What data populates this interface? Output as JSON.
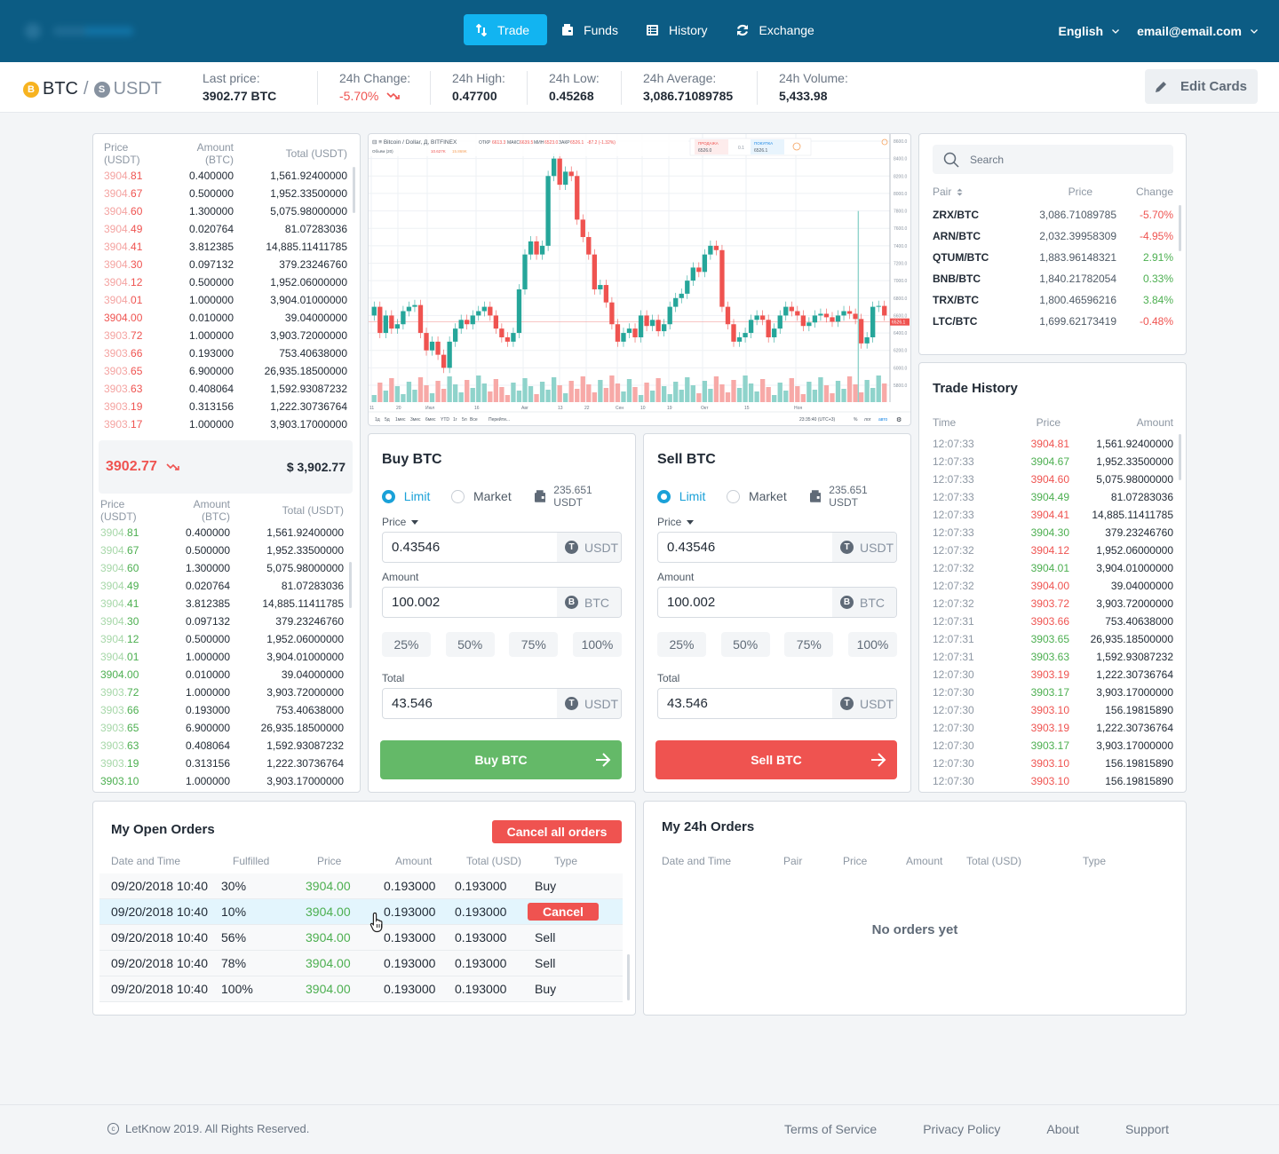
{
  "header": {
    "nav": [
      {
        "label": "Trade",
        "icon": "arrows-swap-icon",
        "active": true
      },
      {
        "label": "Funds",
        "icon": "wallet-icon",
        "active": false
      },
      {
        "label": "History",
        "icon": "list-icon",
        "active": false
      },
      {
        "label": "Exchange",
        "icon": "refresh-icon",
        "active": false
      }
    ],
    "language": "English",
    "account": "email@email.com"
  },
  "ticker": {
    "base": "BTC",
    "separator": "/",
    "quote": "USDT",
    "base_icon": "B",
    "quote_icon": "S",
    "stats": [
      {
        "label": "Last price:",
        "value": "3902.77 BTC"
      },
      {
        "label": "24h Change:",
        "value": "-5.70%",
        "negative": true
      },
      {
        "label": "24h High:",
        "value": "0.47700"
      },
      {
        "label": "24h Low:",
        "value": "0.45268"
      },
      {
        "label": "24h Average:",
        "value": "3,086.71089785"
      },
      {
        "label": "24h Volume:",
        "value": "5,433.98"
      }
    ],
    "edit_cards": "Edit Cards"
  },
  "orderbook": {
    "headers": [
      "Price (USDT)",
      "Amount (BTC)",
      "Total (USDT)"
    ],
    "asks": [
      {
        "int": "3904.",
        "dec": "81",
        "amount": "0.400000",
        "total": "1,561.92400000"
      },
      {
        "int": "3904.",
        "dec": "67",
        "amount": "0.500000",
        "total": "1,952.33500000"
      },
      {
        "int": "3904.",
        "dec": "60",
        "amount": "1.300000",
        "total": "5,075.98000000"
      },
      {
        "int": "3904.",
        "dec": "49",
        "amount": "0.020764",
        "total": "81.07283036"
      },
      {
        "int": "3904.",
        "dec": "41",
        "amount": "3.812385",
        "total": "14,885.11411785"
      },
      {
        "int": "3904.",
        "dec": "30",
        "amount": "0.097132",
        "total": "379.23246760"
      },
      {
        "int": "3904.",
        "dec": "12",
        "amount": "0.500000",
        "total": "1,952.06000000"
      },
      {
        "int": "3904.",
        "dec": "01",
        "amount": "1.000000",
        "total": "3,904.01000000"
      },
      {
        "int": "3904.00",
        "dec": "",
        "amount": "0.010000",
        "total": "39.04000000",
        "full": true
      },
      {
        "int": "3903.",
        "dec": "72",
        "amount": "1.000000",
        "total": "3,903.72000000"
      },
      {
        "int": "3903.",
        "dec": "66",
        "amount": "0.193000",
        "total": "753.40638000"
      },
      {
        "int": "3903.",
        "dec": "65",
        "amount": "6.900000",
        "total": "26,935.18500000"
      },
      {
        "int": "3903.",
        "dec": "63",
        "amount": "0.408064",
        "total": "1,592.93087232"
      },
      {
        "int": "3903.",
        "dec": "19",
        "amount": "0.313156",
        "total": "1,222.30736764"
      },
      {
        "int": "3903.",
        "dec": "17",
        "amount": "1.000000",
        "total": "3,903.17000000"
      }
    ],
    "last_price": "3902.77",
    "last_price_usd": "$ 3,902.77",
    "bids": [
      {
        "int": "3904.",
        "dec": "81",
        "amount": "0.400000",
        "total": "1,561.92400000"
      },
      {
        "int": "3904.",
        "dec": "67",
        "amount": "0.500000",
        "total": "1,952.33500000"
      },
      {
        "int": "3904.",
        "dec": "60",
        "amount": "1.300000",
        "total": "5,075.98000000"
      },
      {
        "int": "3904.",
        "dec": "49",
        "amount": "0.020764",
        "total": "81.07283036"
      },
      {
        "int": "3904.",
        "dec": "41",
        "amount": "3.812385",
        "total": "14,885.11411785"
      },
      {
        "int": "3904.",
        "dec": "30",
        "amount": "0.097132",
        "total": "379.23246760"
      },
      {
        "int": "3904.",
        "dec": "12",
        "amount": "0.500000",
        "total": "1,952.06000000"
      },
      {
        "int": "3904.",
        "dec": "01",
        "amount": "1.000000",
        "total": "3,904.01000000"
      },
      {
        "int": "3904.00",
        "dec": "",
        "amount": "0.010000",
        "total": "39.04000000",
        "full": true
      },
      {
        "int": "3903.",
        "dec": "72",
        "amount": "1.000000",
        "total": "3,903.72000000"
      },
      {
        "int": "3903.",
        "dec": "66",
        "amount": "0.193000",
        "total": "753.40638000"
      },
      {
        "int": "3903.",
        "dec": "65",
        "amount": "6.900000",
        "total": "26,935.18500000"
      },
      {
        "int": "3903.",
        "dec": "63",
        "amount": "0.408064",
        "total": "1,592.93087232"
      },
      {
        "int": "3903.",
        "dec": "19",
        "amount": "0.313156",
        "total": "1,222.30736764"
      },
      {
        "int": "3903.10",
        "dec": "",
        "amount": "1.000000",
        "total": "3,903.17000000",
        "full": true
      }
    ]
  },
  "chart": {
    "title": "Bitcoin / Dollar, Д, BITFINEX",
    "ohlc": {
      "open_label": "ОТКР",
      "open": "6613.3",
      "high_label": "МАКС",
      "high": "6639.5",
      "low_label": "МИН",
      "low": "6523.0",
      "close_label": "ЗАКР",
      "close": "6526.1",
      "change": "-87.2 (-1.32%)"
    },
    "volume_label": "Объём (20)",
    "volume_values": [
      "10.627K",
      "15.869K"
    ],
    "sell_label": "ПРОДАЖА",
    "sell_price": "6526.0",
    "spread": "0.1",
    "buy_label": "ПОКУПКА",
    "buy_price": "6526.1",
    "y_ticks": [
      "8600.0",
      "8400.0",
      "8200.0",
      "8000.0",
      "7800.0",
      "7600.0",
      "7400.0",
      "7200.0",
      "7000.0",
      "6800.0",
      "6600.0",
      "6400.0",
      "6200.0",
      "6000.0",
      "5800.0"
    ],
    "current_price": "6526.1",
    "x_ticks": [
      "11",
      "20",
      "Июл",
      "16",
      "Авг",
      "13",
      "22",
      "Сен",
      "10",
      "19",
      "Окт",
      "15",
      "Ноя"
    ],
    "ranges": [
      "1д",
      "5д",
      "1мес",
      "3мес",
      "6мес",
      "YTD",
      "1г",
      "5л",
      "Все"
    ],
    "goto": "Перейти...",
    "time": "23:35:40 (UTC+3)",
    "options": [
      "%",
      "лог",
      "авто"
    ]
  },
  "buy_form": {
    "title": "Buy BTC",
    "limit": "Limit",
    "market": "Market",
    "balance": "235.651 USDT",
    "price_label": "Price",
    "price": "0.43546",
    "price_unit": "USDT",
    "amount_label": "Amount",
    "amount": "100.002",
    "amount_unit": "BTC",
    "percents": [
      "25%",
      "50%",
      "75%",
      "100%"
    ],
    "total_label": "Total",
    "total": "43.546",
    "total_unit": "USDT",
    "submit": "Buy BTC"
  },
  "sell_form": {
    "title": "Sell BTC",
    "limit": "Limit",
    "market": "Market",
    "balance": "235.651 USDT",
    "price_label": "Price",
    "price": "0.43546",
    "price_unit": "USDT",
    "amount_label": "Amount",
    "amount": "100.002",
    "amount_unit": "BTC",
    "percents": [
      "25%",
      "50%",
      "75%",
      "100%"
    ],
    "total_label": "Total",
    "total": "43.546",
    "total_unit": "USDT",
    "submit": "Sell BTC"
  },
  "pairs": {
    "search_placeholder": "Search",
    "headers": [
      "Pair",
      "Price",
      "Change"
    ],
    "rows": [
      {
        "pair": "ZRX/BTC",
        "price": "3,086.71089785",
        "change": "-5.70%",
        "up": false
      },
      {
        "pair": "ARN/BTC",
        "price": "2,032.39958309",
        "change": "-4.95%",
        "up": false
      },
      {
        "pair": "QTUM/BTC",
        "price": "1,883.96148321",
        "change": "2.91%",
        "up": true
      },
      {
        "pair": "BNB/BTC",
        "price": "1,840.21782054",
        "change": "0.33%",
        "up": true
      },
      {
        "pair": "TRX/BTC",
        "price": "1,800.46596216",
        "change": "3.84%",
        "up": true
      },
      {
        "pair": "LTC/BTC",
        "price": "1,699.62173419",
        "change": "-0.48%",
        "up": false
      }
    ]
  },
  "trade_history": {
    "title": "Trade History",
    "headers": [
      "Time",
      "Price",
      "Amount"
    ],
    "rows": [
      {
        "time": "12:07:33",
        "price": "3904.81",
        "amount": "1,561.92400000",
        "up": false
      },
      {
        "time": "12:07:33",
        "price": "3904.67",
        "amount": "1,952.33500000",
        "up": true
      },
      {
        "time": "12:07:33",
        "price": "3904.60",
        "amount": "5,075.98000000",
        "up": false
      },
      {
        "time": "12:07:33",
        "price": "3904.49",
        "amount": "81.07283036",
        "up": true
      },
      {
        "time": "12:07:33",
        "price": "3904.41",
        "amount": "14,885.11411785",
        "up": false
      },
      {
        "time": "12:07:33",
        "price": "3904.30",
        "amount": "379.23246760",
        "up": true
      },
      {
        "time": "12:07:32",
        "price": "3904.12",
        "amount": "1,952.06000000",
        "up": false
      },
      {
        "time": "12:07:32",
        "price": "3904.01",
        "amount": "3,904.01000000",
        "up": true
      },
      {
        "time": "12:07:32",
        "price": "3904.00",
        "amount": "39.04000000",
        "up": false
      },
      {
        "time": "12:07:32",
        "price": "3903.72",
        "amount": "3,903.72000000",
        "up": false
      },
      {
        "time": "12:07:31",
        "price": "3903.66",
        "amount": "753.40638000",
        "up": false
      },
      {
        "time": "12:07:31",
        "price": "3903.65",
        "amount": "26,935.18500000",
        "up": true
      },
      {
        "time": "12:07:31",
        "price": "3903.63",
        "amount": "1,592.93087232",
        "up": true
      },
      {
        "time": "12:07:30",
        "price": "3903.19",
        "amount": "1,222.30736764",
        "up": false
      },
      {
        "time": "12:07:30",
        "price": "3903.17",
        "amount": "3,903.17000000",
        "up": true
      },
      {
        "time": "12:07:30",
        "price": "3903.10",
        "amount": "156.19815890",
        "up": false
      },
      {
        "time": "12:07:30",
        "price": "3903.19",
        "amount": "1,222.30736764",
        "up": false
      },
      {
        "time": "12:07:30",
        "price": "3903.17",
        "amount": "3,903.17000000",
        "up": true
      },
      {
        "time": "12:07:30",
        "price": "3903.10",
        "amount": "156.19815890",
        "up": false
      },
      {
        "time": "12:07:30",
        "price": "3903.10",
        "amount": "156.19815890",
        "up": false
      }
    ]
  },
  "open_orders": {
    "title": "My Open Orders",
    "cancel_all": "Cancel all orders",
    "headers": [
      "Date and Time",
      "Fulfilled",
      "Price",
      "Amount",
      "Total (USD)",
      "Type"
    ],
    "cancel_label": "Cancel",
    "rows": [
      {
        "date": "09/20/2018 10:40",
        "fulfilled": "30%",
        "price": "3904.00",
        "amount": "0.193000",
        "total": "0.193000",
        "type": "Buy"
      },
      {
        "date": "09/20/2018 10:40",
        "fulfilled": "10%",
        "price": "3904.00",
        "amount": "0.193000",
        "total": "0.193000",
        "type": "Cancel",
        "hover": true
      },
      {
        "date": "09/20/2018 10:40",
        "fulfilled": "56%",
        "price": "3904.00",
        "amount": "0.193000",
        "total": "0.193000",
        "type": "Sell"
      },
      {
        "date": "09/20/2018 10:40",
        "fulfilled": "78%",
        "price": "3904.00",
        "amount": "0.193000",
        "total": "0.193000",
        "type": "Sell"
      },
      {
        "date": "09/20/2018 10:40",
        "fulfilled": "100%",
        "price": "3904.00",
        "amount": "0.193000",
        "total": "0.193000",
        "type": "Buy"
      }
    ]
  },
  "orders_24h": {
    "title": "My 24h Orders",
    "headers": [
      "Date and Time",
      "Pair",
      "Price",
      "Amount",
      "Total (USD)",
      "Type"
    ],
    "empty": "No orders yet"
  },
  "footer": {
    "copyright_symbol": "c",
    "copyright": "LetKnow 2019. All Rights Reserved.",
    "links": [
      "Terms of Service",
      "Privacy Policy",
      "About",
      "Support"
    ]
  },
  "colors": {
    "header_bg": "#0c5c84",
    "accent": "#12b4f1",
    "buy": "#64b968",
    "sell": "#ef5350",
    "up": "#4caf50",
    "down": "#ef5350"
  }
}
